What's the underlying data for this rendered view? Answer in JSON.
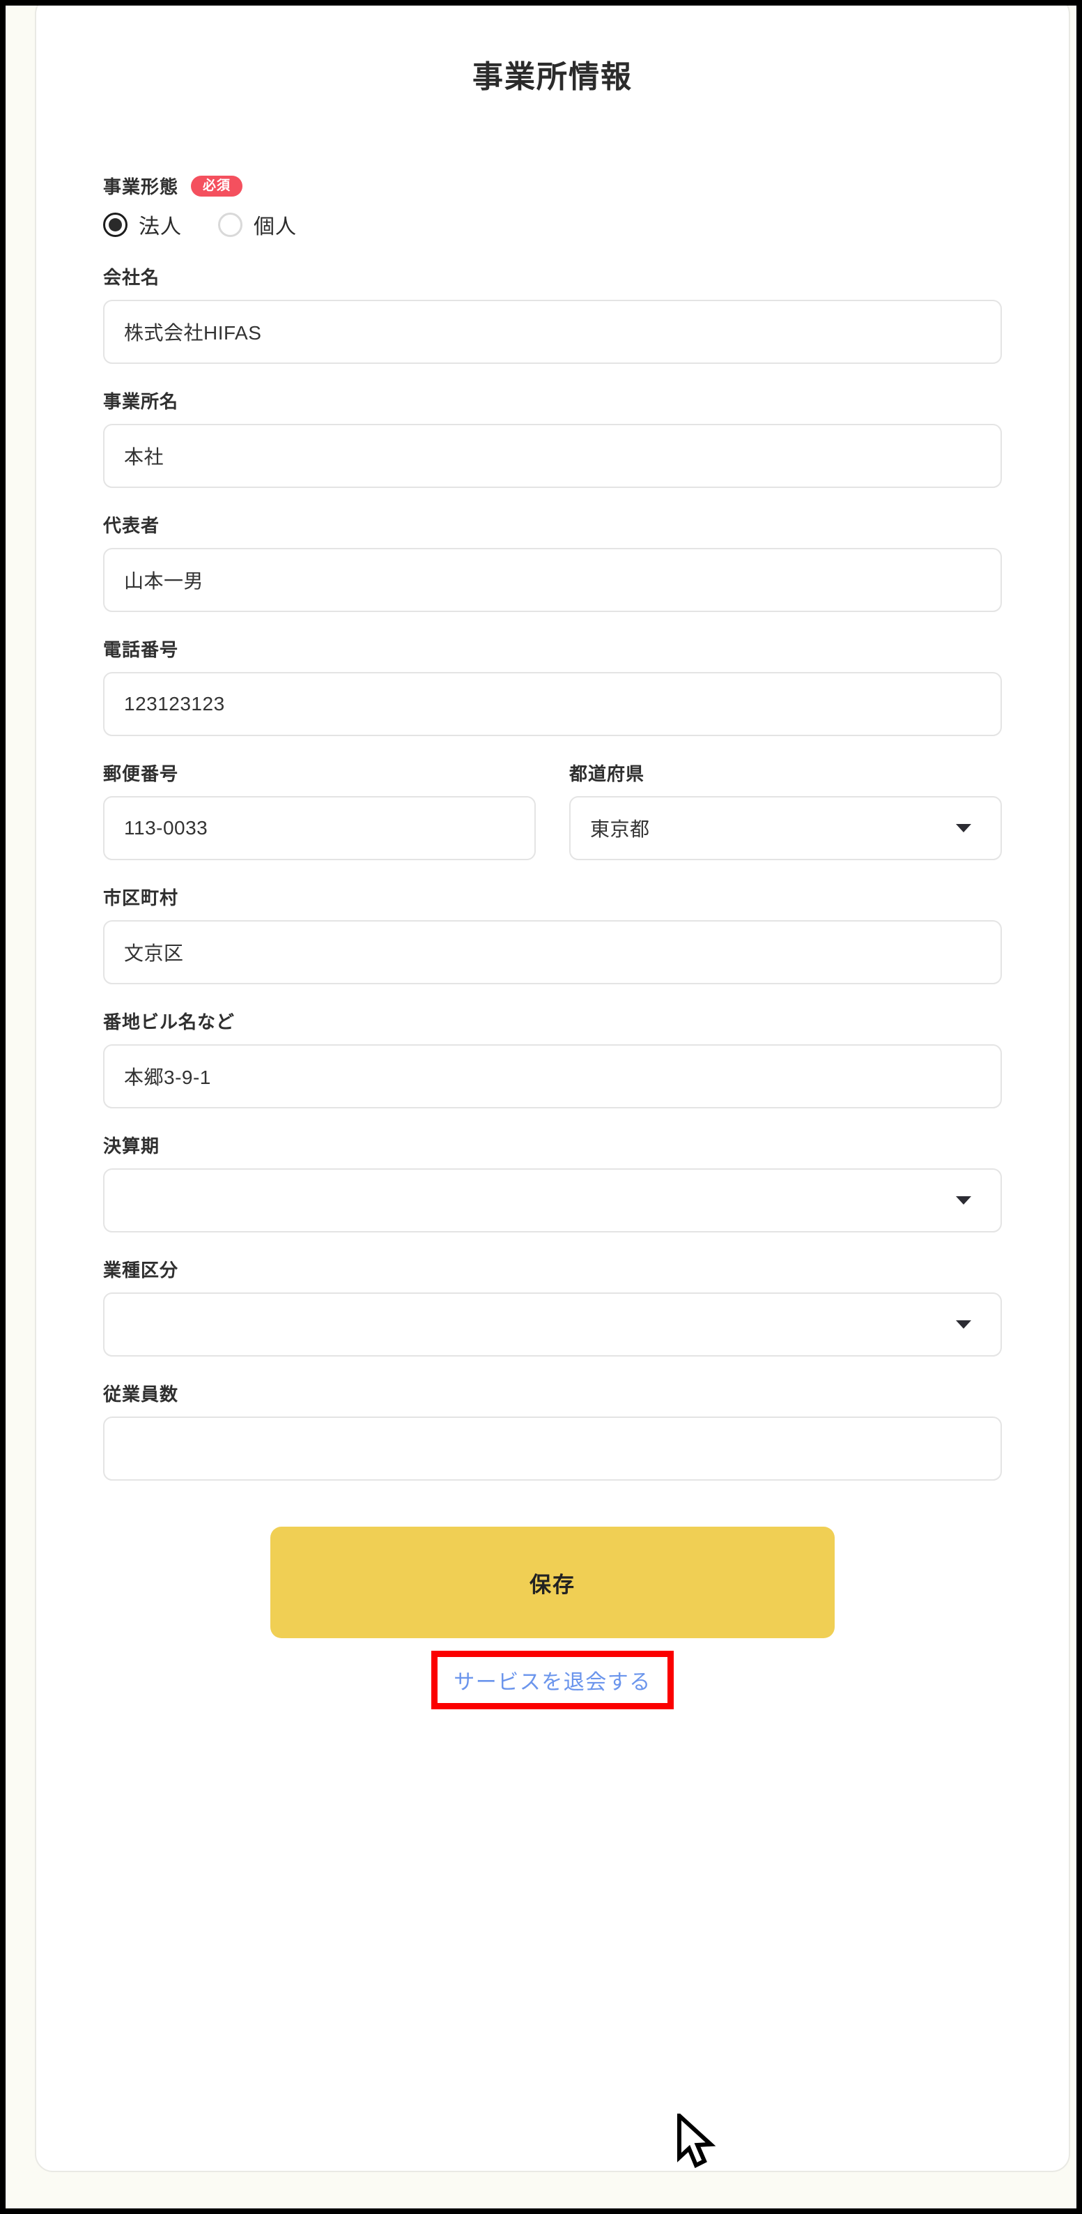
{
  "page": {
    "title": "事業所情報"
  },
  "business_type": {
    "label": "事業形態",
    "required_badge": "必須",
    "options": [
      {
        "label": "法人",
        "selected": true
      },
      {
        "label": "個人",
        "selected": false
      }
    ]
  },
  "fields": {
    "company_name": {
      "label": "会社名",
      "value": "株式会社HIFAS"
    },
    "office_name": {
      "label": "事業所名",
      "value": "本社"
    },
    "representative": {
      "label": "代表者",
      "value": "山本一男"
    },
    "phone": {
      "label": "電話番号",
      "value": "123123123"
    },
    "postal_code": {
      "label": "郵便番号",
      "value": "113-0033"
    },
    "prefecture": {
      "label": "都道府県",
      "value": "東京都",
      "control": "select"
    },
    "city": {
      "label": "市区町村",
      "value": "文京区"
    },
    "street": {
      "label": "番地ビル名など",
      "value": "本郷3-9-1"
    },
    "fiscal_period": {
      "label": "決算期",
      "value": "",
      "control": "select"
    },
    "industry": {
      "label": "業種区分",
      "value": "",
      "control": "select"
    },
    "employees": {
      "label": "従業員数",
      "value": ""
    }
  },
  "actions": {
    "save_label": "保存",
    "withdraw_label": "サービスを退会する"
  },
  "colors": {
    "required_badge_bg": "#f4505e",
    "save_button_bg": "#f0cf54",
    "withdraw_link": "#6b95ec",
    "annotation_box": "#fb0000"
  }
}
